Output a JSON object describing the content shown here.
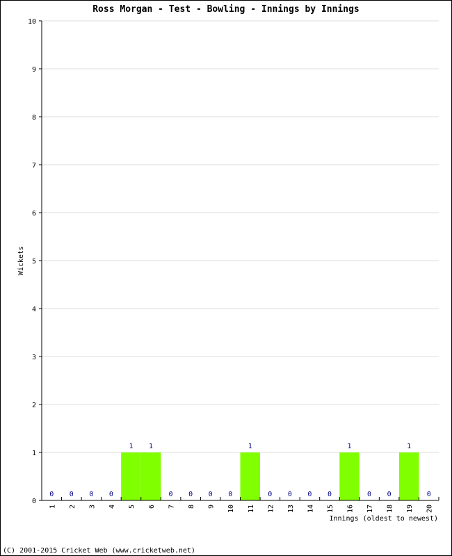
{
  "chart_data": {
    "type": "bar",
    "title": "Ross Morgan - Test - Bowling - Innings by Innings",
    "xlabel": "Innings (oldest to newest)",
    "ylabel": "Wickets",
    "ylim": [
      0,
      10
    ],
    "yticks": [
      0,
      1,
      2,
      3,
      4,
      5,
      6,
      7,
      8,
      9,
      10
    ],
    "grid": true,
    "categories": [
      "1",
      "2",
      "3",
      "4",
      "5",
      "6",
      "7",
      "8",
      "9",
      "10",
      "11",
      "12",
      "13",
      "14",
      "15",
      "16",
      "17",
      "18",
      "19",
      "20"
    ],
    "values": [
      0,
      0,
      0,
      0,
      1,
      1,
      0,
      0,
      0,
      0,
      1,
      0,
      0,
      0,
      0,
      1,
      0,
      0,
      1,
      0
    ],
    "bar_color": "#80ff00",
    "label_color": "#000080",
    "grid_color": "#dddddd"
  },
  "footer": "(C) 2001-2015 Cricket Web (www.cricketweb.net)"
}
